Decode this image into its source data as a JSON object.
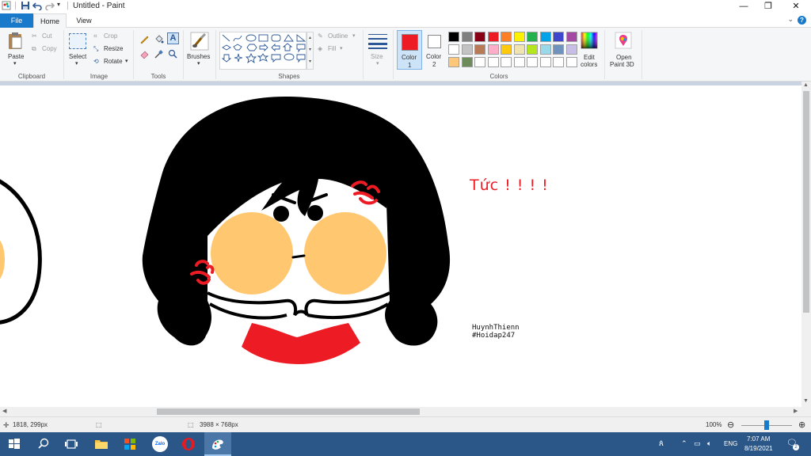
{
  "window": {
    "title": "Untitled - Paint",
    "minimize": "—",
    "restore": "❐",
    "close": "✕"
  },
  "tabs": {
    "file": "File",
    "home": "Home",
    "view": "View"
  },
  "ribbon": {
    "clipboard": {
      "paste": "Paste",
      "cut": "Cut",
      "copy": "Copy",
      "label": "Clipboard"
    },
    "image": {
      "select": "Select",
      "crop": "Crop",
      "resize": "Resize",
      "rotate": "Rotate",
      "label": "Image"
    },
    "tools": {
      "label": "Tools"
    },
    "brushes": {
      "label": "Brushes"
    },
    "shapes": {
      "outline": "Outline",
      "fill": "Fill",
      "label": "Shapes"
    },
    "size": {
      "label": "Size"
    },
    "color1": {
      "label": "Color",
      "num": "1",
      "value": "#ed1c24"
    },
    "color2": {
      "label": "Color",
      "num": "2",
      "value": "#ffffff"
    },
    "edit_colors": {
      "line1": "Edit",
      "line2": "colors"
    },
    "paint3d": {
      "line1": "Open",
      "line2": "Paint 3D"
    },
    "colors_label": "Colors",
    "palette_row1": [
      "#000000",
      "#7f7f7f",
      "#880015",
      "#ed1c24",
      "#ff7f27",
      "#fff200",
      "#22b14c",
      "#00a2e8",
      "#3f48cc",
      "#a349a4"
    ],
    "palette_row2": [
      "#ffffff",
      "#c3c3c3",
      "#b97a57",
      "#ffaec9",
      "#ffc90e",
      "#efe4b0",
      "#b5e61d",
      "#99d9ea",
      "#7092be",
      "#c8bfe7"
    ],
    "palette_row3": [
      "#ffc779",
      "#6e8b5a",
      "#ffffff",
      "#ffffff",
      "#ffffff",
      "#ffffff",
      "#ffffff",
      "#ffffff",
      "#ffffff",
      "#ffffff"
    ]
  },
  "canvas": {
    "caption": "Tức ! ! ! !",
    "signature_line1": "HuynhThienn",
    "signature_line2": "#Hoidap247",
    "colors": {
      "hair": "#000000",
      "cheek": "#ffc76f",
      "mouth": "#ed1c24",
      "anger": "#ed1c24"
    }
  },
  "status": {
    "cursor_pos": "1818, 299px",
    "image_size": "3988 × 768px",
    "zoom": "100%"
  },
  "taskbar": {
    "time": "7:07 AM",
    "date": "8/19/2021",
    "lang": "ENG",
    "notifications": "2",
    "zalo": "Zalo"
  }
}
